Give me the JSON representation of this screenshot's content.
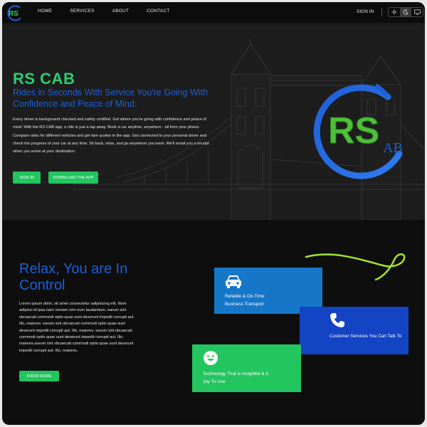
{
  "nav": {
    "links": [
      "HOME",
      "SERVICES",
      "ABOUT",
      "CONTACT"
    ],
    "signin": "SIGN IN"
  },
  "hero": {
    "title": "RS CAB",
    "subtitle": "Rides in Seconds With Service You're Going With Confidence and Peace of Mind.",
    "description": "Every driver is background checked and safety certified. Get where you're going with confidence and peace of mind. With the RS CAB app, a ride is just a tap away. Book a car anytime, anywhere - all from your phone. Compare rates for different vehicles and get fare quotes in the app. Get connected to your personal driver and check the progress of your car at any time. Sit back, relax, and go anywhere you want. We'll email you a receipt when you arrive at your destination.",
    "signin_button": "SIGN IN",
    "download_button": "DOWNLOAD THE APP",
    "logo_text": "RS",
    "logo_suffix": "AB"
  },
  "relax": {
    "title": "Relax, You are In Control",
    "description": "Lorem ipsum dolor, sit amet consectetur adipisicing elit. Illum adipisci id ipsa nam veniam rem eum laudantium, earum sint obcaecati commodi optio quae sunt deserunt impedit corrupti aut. Illo, maiores. earum sint obcaecati commodi optio quae sunt deserunt impedit corrupti aut. Illo, maiores. earum sint obcaecati commodi optio quae sunt deserunt impedit corrupti aut. Illo, maiores.earum sint obcaecati commodi optio quae sunt deserunt impedit corrupti aut. Illo, maiores.",
    "know_more": "KNOW MORE"
  },
  "cards": [
    {
      "text": "Reliable & On-Time Business Transport",
      "icon": "car-icon",
      "color": "#1677c9"
    },
    {
      "text": "Customer Services You Can Talk To",
      "icon": "phone-icon",
      "color": "#1244c4"
    },
    {
      "text": "Technology That is Insightful & A Joy To Use",
      "icon": "smile-icon",
      "color": "#22c55e"
    }
  ],
  "colors": {
    "accent_green": "#2ecc71",
    "accent_blue": "#1f5fd6",
    "background": "#111111"
  }
}
